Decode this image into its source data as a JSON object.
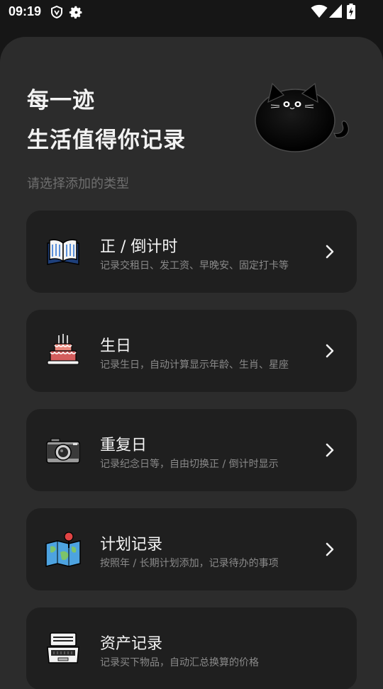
{
  "status": {
    "time": "09:19"
  },
  "header": {
    "title": "每一迹",
    "subtitle": "生活值得你记录",
    "hint": "请选择添加的类型"
  },
  "cards": [
    {
      "title": "正 / 倒计时",
      "desc": "记录交租日、发工资、早晚安、固定打卡等",
      "icon": "book-icon"
    },
    {
      "title": "生日",
      "desc": "记录生日，自动计算显示年龄、生肖、星座",
      "icon": "birthday-cake-icon"
    },
    {
      "title": "重复日",
      "desc": "记录纪念日等，自由切换正 / 倒计时显示",
      "icon": "camera-icon"
    },
    {
      "title": "计划记录",
      "desc": "按照年 / 长期计划添加，记录待办的事项",
      "icon": "map-pin-icon"
    },
    {
      "title": "资产记录",
      "desc": "记录买下物品，自动汇总换算的价格",
      "icon": "laptop-icon"
    }
  ],
  "colors": {
    "background": "#161616",
    "sheet": "#2c2c2c",
    "card": "#1f1f1f",
    "text_primary": "#f4f4f4",
    "text_secondary": "#8a8a8a"
  }
}
